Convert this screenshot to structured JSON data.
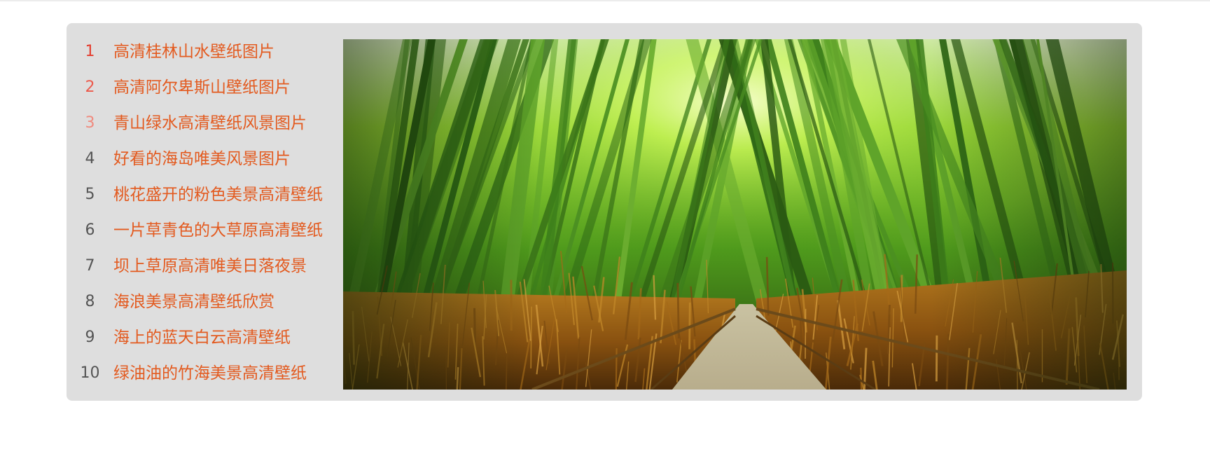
{
  "ranking": {
    "items": [
      {
        "rank": "1",
        "title": "高清桂林山水壁纸图片"
      },
      {
        "rank": "2",
        "title": "高清阿尔卑斯山壁纸图片"
      },
      {
        "rank": "3",
        "title": "青山绿水高清壁纸风景图片"
      },
      {
        "rank": "4",
        "title": "好看的海岛唯美风景图片"
      },
      {
        "rank": "5",
        "title": "桃花盛开的粉色美景高清壁纸"
      },
      {
        "rank": "6",
        "title": "一片草青色的大草原高清壁纸"
      },
      {
        "rank": "7",
        "title": "坝上草原高清唯美日落夜景"
      },
      {
        "rank": "8",
        "title": "海浪美景高清壁纸欣赏"
      },
      {
        "rank": "9",
        "title": "海上的蓝天白云高清壁纸"
      },
      {
        "rank": "10",
        "title": "绿油油的竹海美景高清壁纸"
      }
    ]
  },
  "featured_image": {
    "subject": "bamboo forest path",
    "icon": "bamboo-forest-photo"
  },
  "colors": {
    "panel_bg": "#dedede",
    "title_link": "#e35a1f",
    "rank_1": "#e43c2e",
    "rank_2": "#ec5a4c",
    "rank_3": "#f08a7e",
    "rank_default": "#555555"
  }
}
